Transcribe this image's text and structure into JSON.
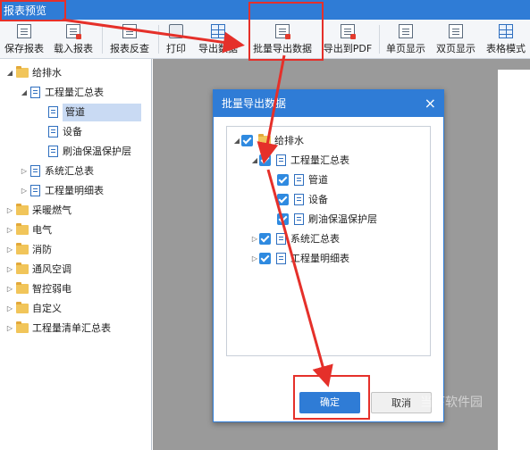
{
  "window": {
    "title": "报表预览"
  },
  "toolbar": {
    "buttons": [
      {
        "label": "保存报表",
        "icon": "save-icon"
      },
      {
        "label": "载入报表",
        "icon": "load-icon"
      },
      {
        "label": "报表反查",
        "icon": "search-report-icon"
      },
      {
        "label": "打印",
        "icon": "print-icon"
      },
      {
        "label": "导出数据",
        "icon": "export-icon"
      },
      {
        "label": "批量导出数据",
        "icon": "batch-export-icon"
      },
      {
        "label": "导出到PDF",
        "icon": "pdf-icon"
      },
      {
        "label": "单页显示",
        "icon": "single-page-icon"
      },
      {
        "label": "双页显示",
        "icon": "double-page-icon"
      },
      {
        "label": "表格模式",
        "icon": "table-mode-icon"
      }
    ]
  },
  "left_tree": [
    {
      "label": "给排水",
      "type": "folder",
      "expanded": true
    },
    {
      "label": "工程量汇总表",
      "type": "doc",
      "expanded": true
    },
    {
      "label": "管道",
      "type": "doc",
      "selected": true
    },
    {
      "label": "设备",
      "type": "doc"
    },
    {
      "label": "刷油保温保护层",
      "type": "doc"
    },
    {
      "label": "系统汇总表",
      "type": "doc"
    },
    {
      "label": "工程量明细表",
      "type": "doc"
    },
    {
      "label": "采暖燃气",
      "type": "folder"
    },
    {
      "label": "电气",
      "type": "folder"
    },
    {
      "label": "消防",
      "type": "folder"
    },
    {
      "label": "通风空调",
      "type": "folder"
    },
    {
      "label": "智控弱电",
      "type": "folder"
    },
    {
      "label": "自定义",
      "type": "folder"
    },
    {
      "label": "工程量清单汇总表",
      "type": "folder"
    }
  ],
  "dialog": {
    "title": "批量导出数据",
    "close": "×",
    "tree": [
      {
        "label": "给排水",
        "checked": true
      },
      {
        "label": "工程量汇总表",
        "checked": true
      },
      {
        "label": "管道",
        "checked": true
      },
      {
        "label": "设备",
        "checked": true
      },
      {
        "label": "刷油保温保护层",
        "checked": true
      },
      {
        "label": "系统汇总表",
        "checked": true
      },
      {
        "label": "工程量明细表",
        "checked": true
      }
    ],
    "ok_label": "确定",
    "cancel_label": "取消"
  },
  "watermark": {
    "text": "当下软件园"
  },
  "colors": {
    "accent": "#2f7cd6",
    "highlight": "#e5302a",
    "preview_bg": "#9a9a9a"
  }
}
